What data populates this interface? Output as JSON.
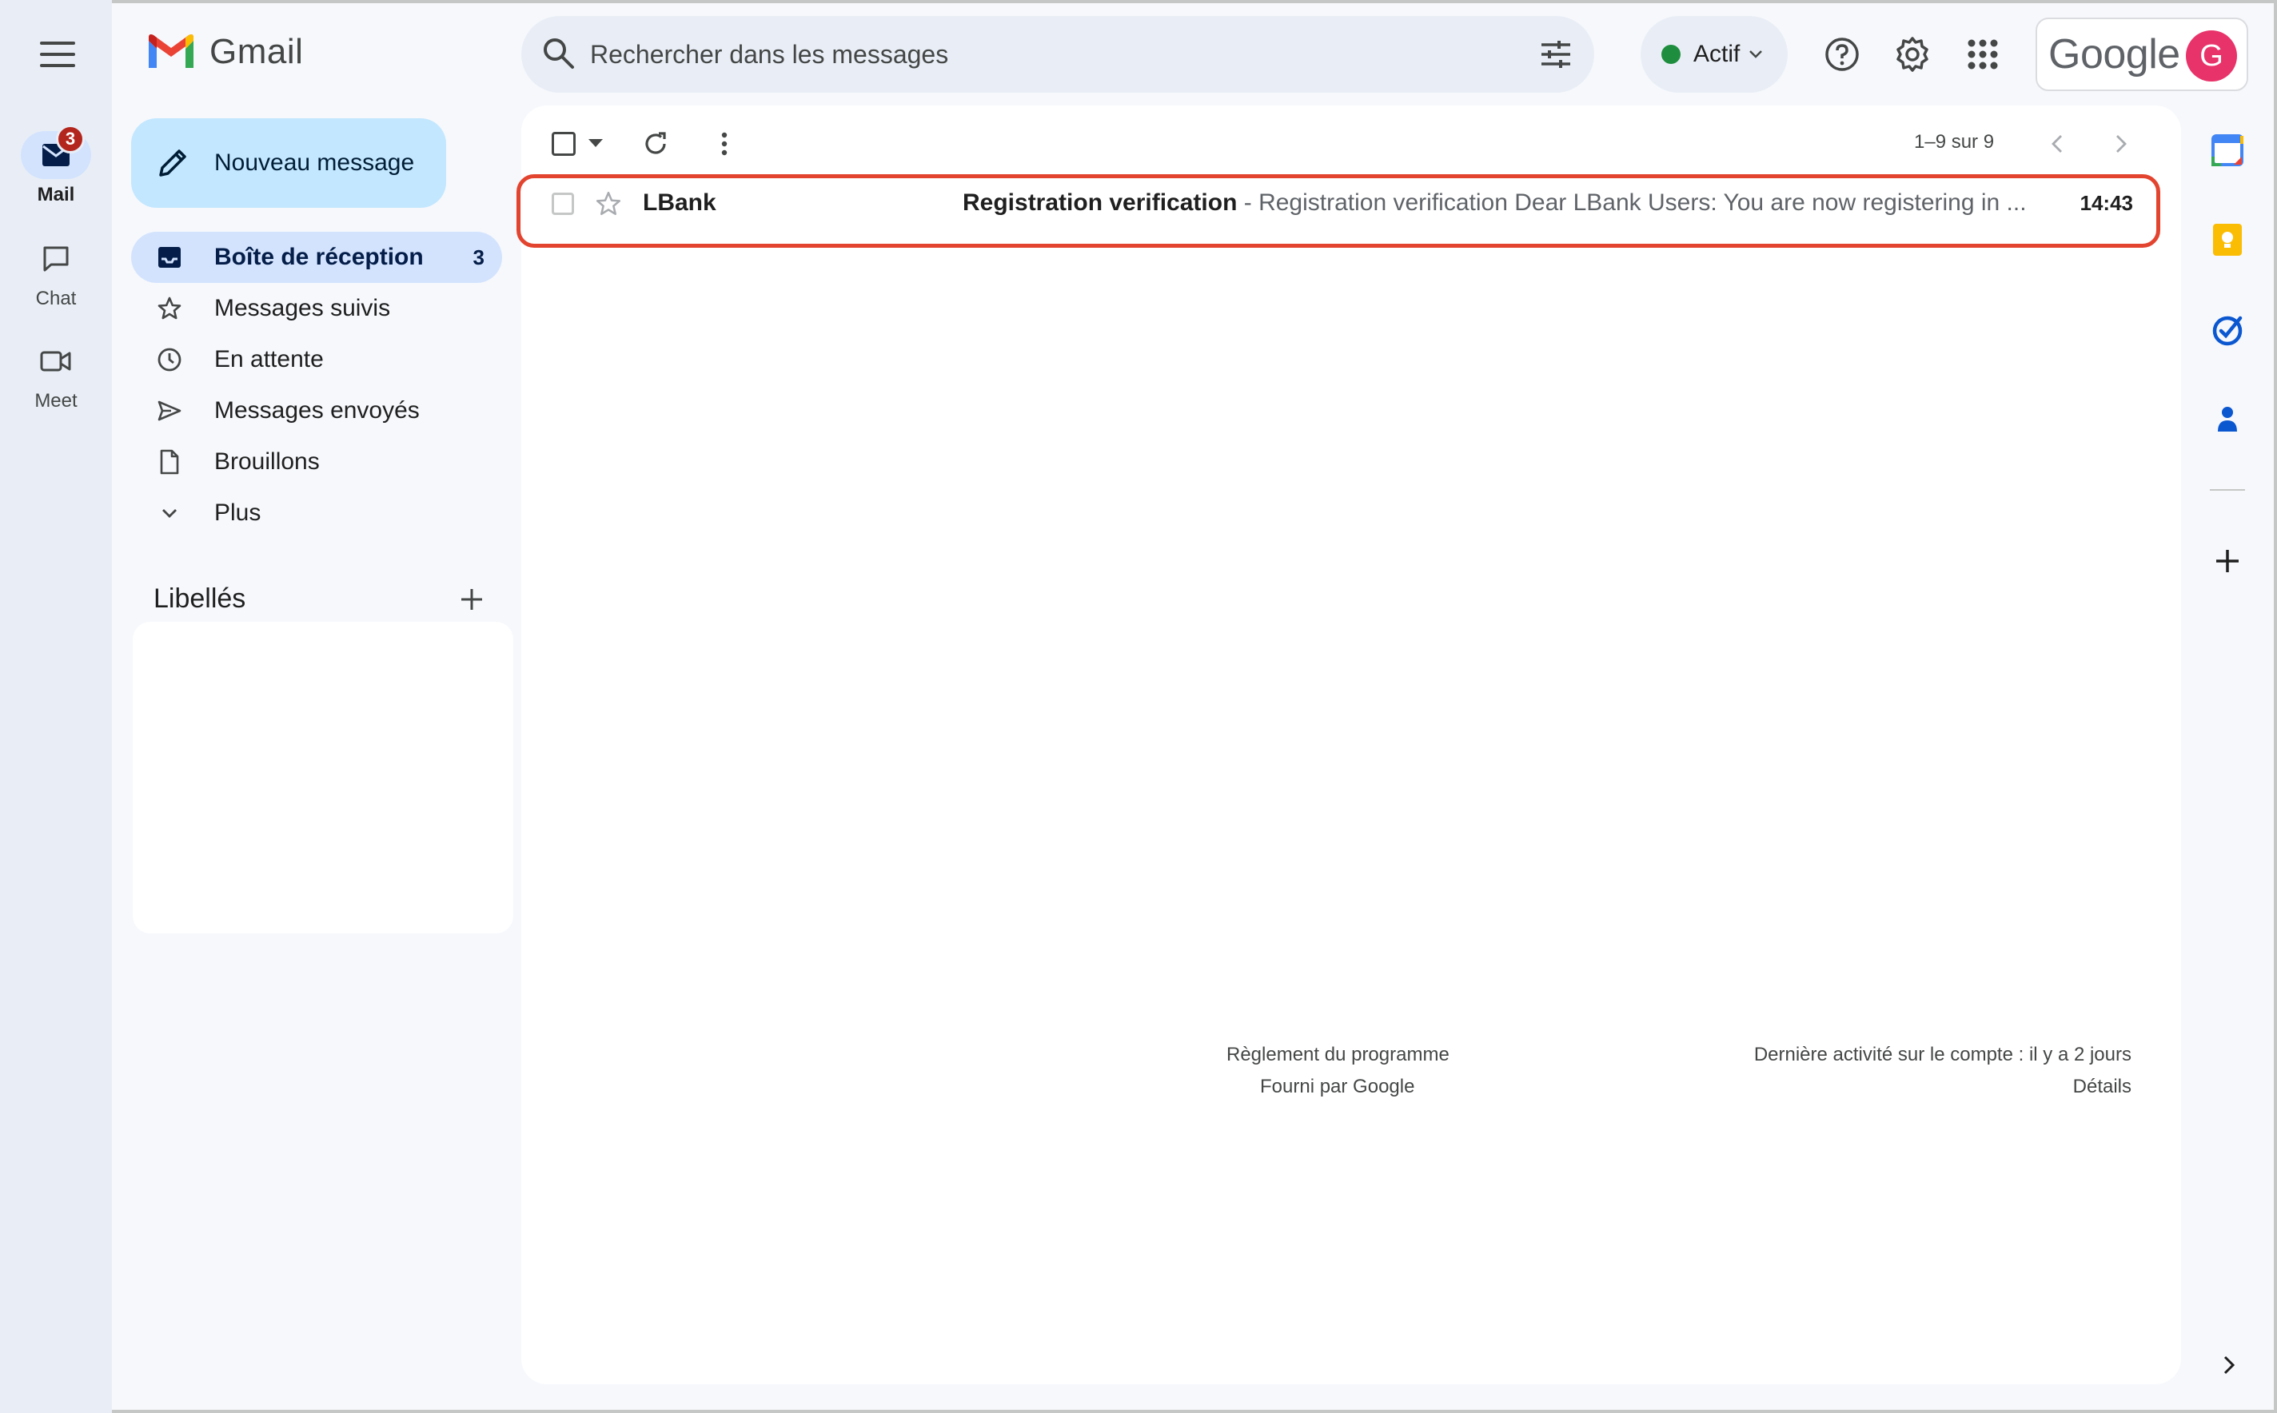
{
  "app": {
    "name": "Gmail"
  },
  "rail": {
    "items": [
      {
        "label": "Mail",
        "badge": "3"
      },
      {
        "label": "Chat"
      },
      {
        "label": "Meet"
      }
    ]
  },
  "search": {
    "placeholder": "Rechercher dans les messages"
  },
  "status": {
    "label": "Actif",
    "color": "#1e8e3e"
  },
  "account": {
    "brand": "Google",
    "avatar_initial": "G",
    "avatar_color": "#e8336a"
  },
  "compose": {
    "label": "Nouveau message"
  },
  "nav": {
    "items": [
      {
        "label": "Boîte de réception",
        "count": "3",
        "icon": "inbox-icon"
      },
      {
        "label": "Messages suivis",
        "icon": "star-icon"
      },
      {
        "label": "En attente",
        "icon": "clock-icon"
      },
      {
        "label": "Messages envoyés",
        "icon": "send-icon"
      },
      {
        "label": "Brouillons",
        "icon": "draft-icon"
      },
      {
        "label": "Plus",
        "icon": "chevron-down-icon"
      }
    ]
  },
  "labels": {
    "title": "Libellés"
  },
  "toolbar": {
    "pager_text": "1–9 sur 9"
  },
  "emails": [
    {
      "sender": "LBank",
      "subject": "Registration verification",
      "separator": " - ",
      "snippet": "Registration verification Dear LBank Users: You are now registering in ...",
      "time": "14:43"
    }
  ],
  "footer": {
    "program_policy": "Règlement du programme",
    "powered_by": "Fourni par Google",
    "last_activity": "Dernière activité sur le compte : il y a 2 jours",
    "details": "Détails"
  },
  "colors": {
    "accent": "#0b57d0",
    "highlight": "#e2442f",
    "badge": "#b3261e"
  }
}
